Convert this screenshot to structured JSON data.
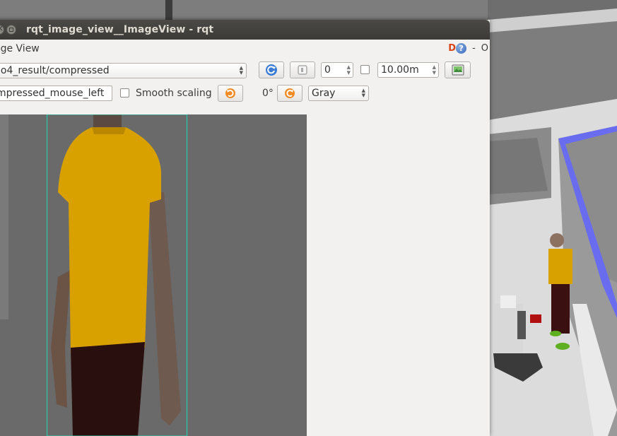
{
  "window": {
    "title": "rqt_image_view__ImageView - rqt"
  },
  "dock": {
    "title": "age View",
    "d_label": "D",
    "help_icon": "help-icon",
    "minimize_label": "-",
    "close_label": "O"
  },
  "toolbar": {
    "topic": "lo4_result/compressed",
    "refresh_icon": "refresh-icon",
    "fit_icon": "fit-view-icon",
    "zoom_value": "0",
    "dynamic_range_checked": false,
    "max_range": "10.00m",
    "save_icon": "save-image-icon"
  },
  "toolbar2": {
    "mouse_topic": "mpressed_mouse_left",
    "smooth_label": "Smooth scaling",
    "smooth_checked": false,
    "rotate_left_icon": "rotate-ccw-icon",
    "rotation": "0°",
    "rotate_right_icon": "rotate-cw-icon",
    "color_scheme": "Gray"
  },
  "colors": {
    "detection_box": "#1fd8b0",
    "shirt": "#d9a100",
    "pants": "#2a0f0f",
    "wall_highlight": "#6a6cf0"
  }
}
